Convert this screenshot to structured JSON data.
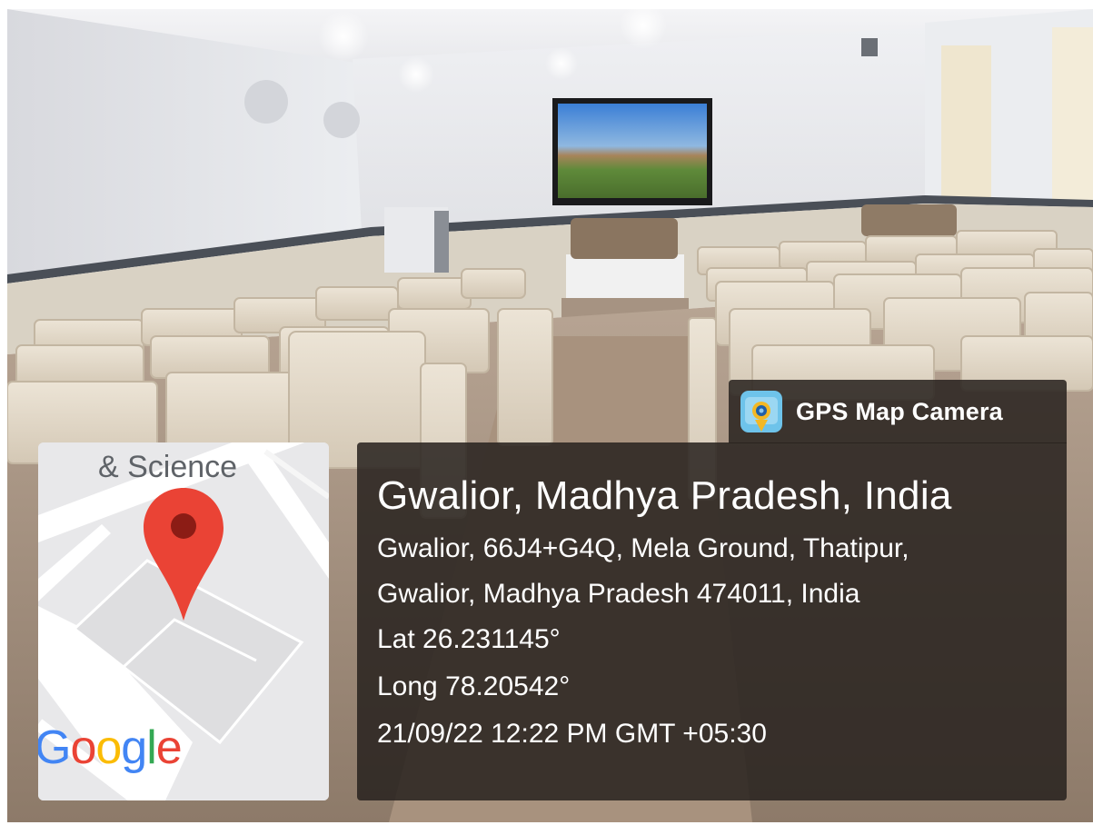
{
  "overlay": {
    "app_badge": {
      "icon": "gps-map-camera-icon",
      "label": "GPS Map Camera"
    },
    "location": {
      "title": "Gwalior, Madhya Pradesh, India",
      "address_line1": "Gwalior, 66J4+G4Q, Mela Ground, Thatipur,",
      "address_line2": "Gwalior, Madhya Pradesh 474011, India",
      "latitude": "Lat 26.231145°",
      "longitude": "Long 78.20542°",
      "datetime": "21/09/22 12:22 PM GMT +05:30"
    },
    "map_thumbnail": {
      "label": "& Science",
      "watermark_letters": [
        "G",
        "o",
        "o",
        "g",
        "l",
        "e"
      ],
      "watermark_colors": [
        "#4285F4",
        "#EA4335",
        "#FBBC05",
        "#4285F4",
        "#34A853",
        "#EA4335"
      ],
      "pin_icon": "map-pin-icon"
    }
  },
  "colors": {
    "panel_background": "#28221e",
    "pin_red": "#ea4335"
  }
}
